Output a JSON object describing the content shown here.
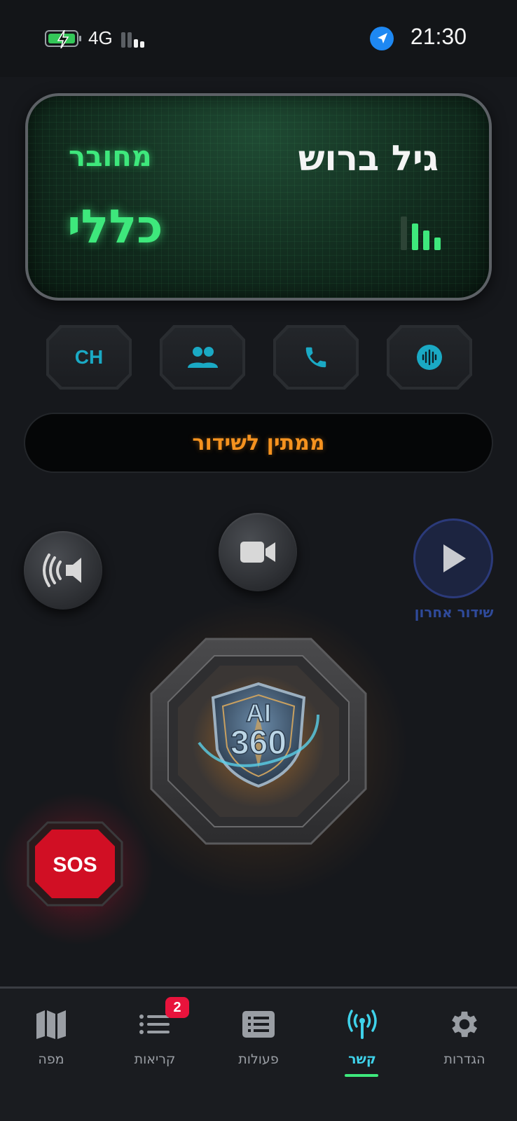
{
  "status_bar": {
    "network": "4G",
    "time": "21:30",
    "icons": [
      "battery-charging-icon",
      "signal-icon",
      "location-arrow-icon"
    ]
  },
  "card": {
    "user_name": "גיל ברוש",
    "connection_status": "מחובר",
    "channel": "כללי",
    "colors": {
      "accent": "#3ee87c"
    }
  },
  "quick_buttons": [
    {
      "label": "CH",
      "name": "channel-button"
    },
    {
      "icon": "group-icon",
      "name": "group-button"
    },
    {
      "icon": "phone-icon",
      "name": "call-button"
    },
    {
      "icon": "voice-wave-icon",
      "name": "voice-button"
    }
  ],
  "transmission_status": "ממתין לשידור",
  "controls": {
    "speaker_icon": "speaker-icon",
    "video_icon": "video-camera-icon",
    "replay_label": "שידור אחרון"
  },
  "ptt_logo_text": "AI 360",
  "sos_label": "SOS",
  "tabs": [
    {
      "label": "הגדרות",
      "icon": "gear-icon",
      "active": false
    },
    {
      "label": "קשר",
      "icon": "antenna-icon",
      "active": true
    },
    {
      "label": "פעולות",
      "icon": "list-panel-icon",
      "active": false
    },
    {
      "label": "קריאות",
      "icon": "list-icon",
      "active": false,
      "badge": "2"
    },
    {
      "label": "מפה",
      "icon": "map-icon",
      "active": false
    }
  ]
}
